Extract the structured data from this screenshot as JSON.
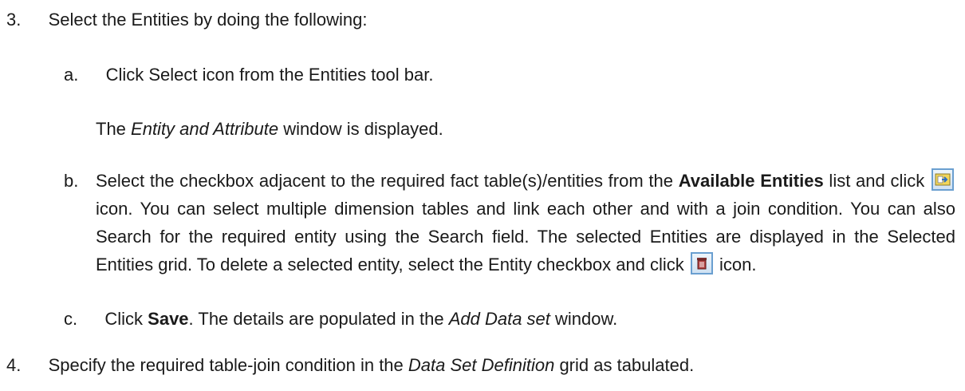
{
  "step3": {
    "number": "3.",
    "text": "Select the Entities by doing the following:"
  },
  "step3a": {
    "letter": "a.",
    "text": "Click Select icon from the Entities tool bar.",
    "note_prefix": "The ",
    "note_italic": "Entity and Attribute",
    "note_suffix": " window is displayed."
  },
  "step3b": {
    "letter": "b.",
    "part1": "Select the checkbox adjacent to the required fact table(s)/entities from the ",
    "bold1": "Available Entities",
    "part2": " list and click ",
    "part3": " icon. You can select multiple dimension tables and link each other and with a join condition. You can also Search for the required entity using the Search field. The selected Entities are displayed in the Selected Entities grid. To delete a selected entity, select the Entity checkbox and click ",
    "part4": " icon."
  },
  "step3c": {
    "letter": "c.",
    "prefix": "Click ",
    "bold": "Save",
    "middle": ". The details are populated in the ",
    "italic": "Add Data set",
    "suffix": " window."
  },
  "step4": {
    "number": "4.",
    "prefix": "Specify the required table-join condition in the ",
    "italic": "Data Set Definition",
    "suffix": " grid as tabulated."
  },
  "icons": {
    "select_icon": "select-entity-icon",
    "delete_icon": "delete-entity-icon",
    "accent": "#6a9fd0"
  }
}
